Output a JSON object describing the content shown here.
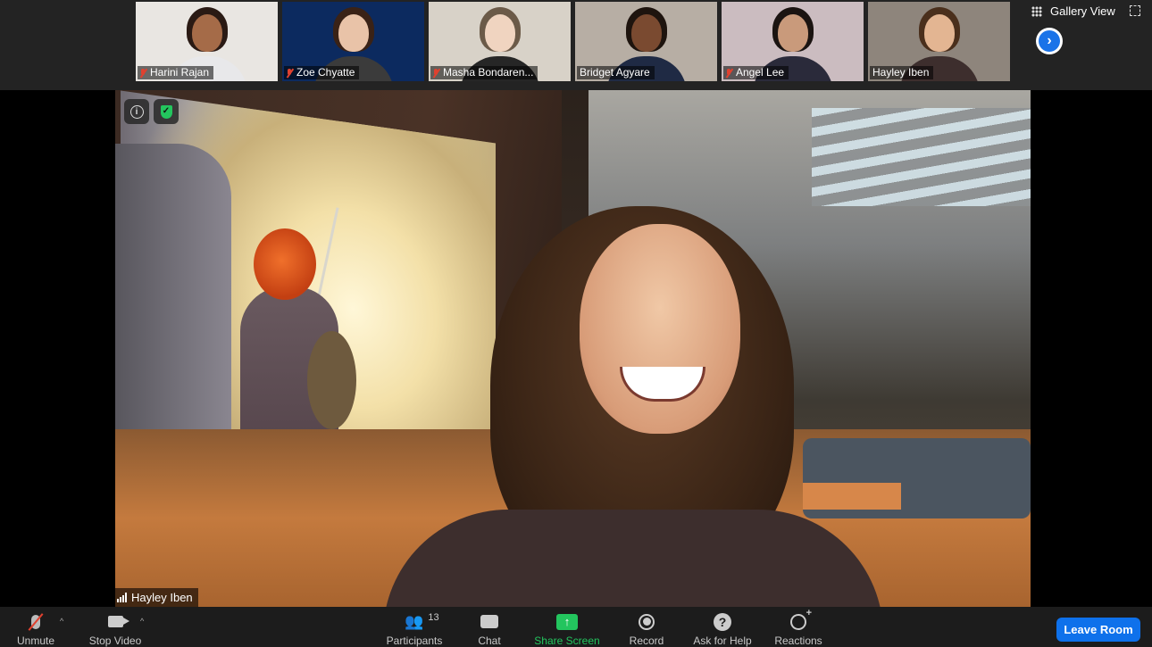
{
  "participants": [
    {
      "name": "Harini Rajan",
      "muted": true,
      "bg": "#e9e6e2",
      "hair": "#2a1a14",
      "skin": "#a56b48",
      "shirt": "#e8e8ea"
    },
    {
      "name": "Zoe Chyatte",
      "muted": true,
      "bg": "#0c2a5f",
      "hair": "#3a2216",
      "skin": "#e9c3a8",
      "shirt": "#3b3b3b"
    },
    {
      "name": "Masha Bondaren...",
      "muted": true,
      "bg": "#d8d2c8",
      "hair": "#6b5a48",
      "skin": "#f0d4c0",
      "shirt": "#262626"
    },
    {
      "name": "Bridget Agyare",
      "muted": false,
      "bg": "#b7aea4",
      "hair": "#1e140e",
      "skin": "#7a4a30",
      "shirt": "#1f2a44"
    },
    {
      "name": "Angel Lee",
      "muted": true,
      "bg": "#cbbcc0",
      "hair": "#1b1411",
      "skin": "#c99a7b",
      "shirt": "#2a2a3a"
    },
    {
      "name": "Hayley Iben",
      "muted": false,
      "bg": "#8e857c",
      "hair": "#4a2f1c",
      "skin": "#e3b592",
      "shirt": "#3d2e2d",
      "active": true
    }
  ],
  "top_right": {
    "gallery_view_label": "Gallery View"
  },
  "speaker": {
    "name": "Hayley Iben"
  },
  "toolbar": {
    "unmute": "Unmute",
    "stop_video": "Stop Video",
    "participants": "Participants",
    "participants_count": "13",
    "chat": "Chat",
    "share_screen": "Share Screen",
    "record": "Record",
    "ask_for_help": "Ask for Help",
    "reactions": "Reactions",
    "leave_room": "Leave Room"
  },
  "colors": {
    "share_green": "#23c55e",
    "leave_blue": "#0e71eb",
    "active_border": "#d6d86a",
    "muted_red": "#e0412f"
  }
}
